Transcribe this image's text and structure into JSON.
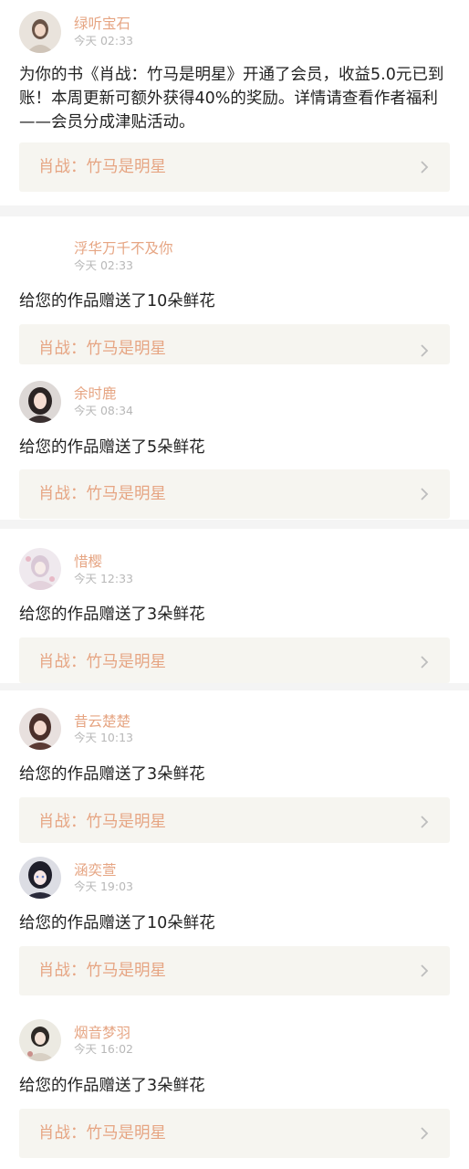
{
  "notifications": [
    {
      "name": "绿听宝石",
      "time": "今天 02:33",
      "message": "为你的书《肖战：竹马是明星》开通了会员，收益5.0元已到账！本周更新可额外获得40%的奖励。详情请查看作者福利——会员分成津贴活动。",
      "book": "肖战：竹马是明星"
    },
    {
      "name": "浮华万千不及你",
      "time": "今天 02:33",
      "message": "给您的作品赠送了10朵鲜花",
      "book": "肖战：竹马是明星"
    },
    {
      "name": "余时鹿",
      "time": "今天 08:34",
      "message": "给您的作品赠送了5朵鲜花",
      "book": "肖战：竹马是明星"
    },
    {
      "name": "惜樱",
      "time": "今天 12:33",
      "message": "给您的作品赠送了3朵鲜花",
      "book": "肖战：竹马是明星"
    },
    {
      "name": "昔云楚楚",
      "time": "今天 10:13",
      "message": "给您的作品赠送了3朵鲜花",
      "book": "肖战：竹马是明星"
    },
    {
      "name": "涵奕萱",
      "time": "今天 19:03",
      "message": "给您的作品赠送了10朵鲜花",
      "book": "肖战：竹马是明星"
    },
    {
      "name": "烟音梦羽",
      "time": "今天 16:02",
      "message": "给您的作品赠送了3朵鲜花",
      "book": "肖战：竹马是明星"
    }
  ],
  "colors": {
    "accent": "#e6a583",
    "text": "#222222",
    "muted": "#b8b8b8",
    "card": "#f6f5f0",
    "separator": "#f4f4f4"
  },
  "icons": {
    "chevron": "chevron-right-icon",
    "avatar": "avatar"
  }
}
